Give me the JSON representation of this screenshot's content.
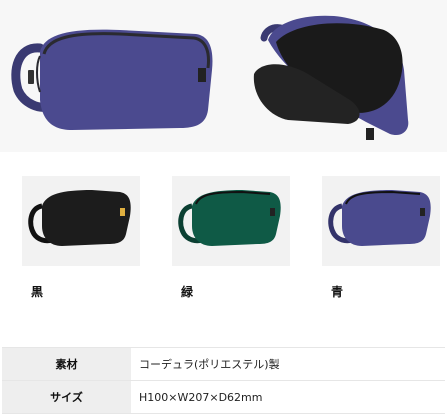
{
  "variants": [
    {
      "label": "黒",
      "color": "#1c1c1c"
    },
    {
      "label": "緑",
      "color": "#0f5a46"
    },
    {
      "label": "青",
      "color": "#4a4a8e"
    }
  ],
  "main_color": "#4b4a8f",
  "specs": [
    {
      "key": "素材",
      "value": "コーデュラ(ポリエステル)製"
    },
    {
      "key": "サイズ",
      "value": "H100×W207×D62mm"
    }
  ]
}
